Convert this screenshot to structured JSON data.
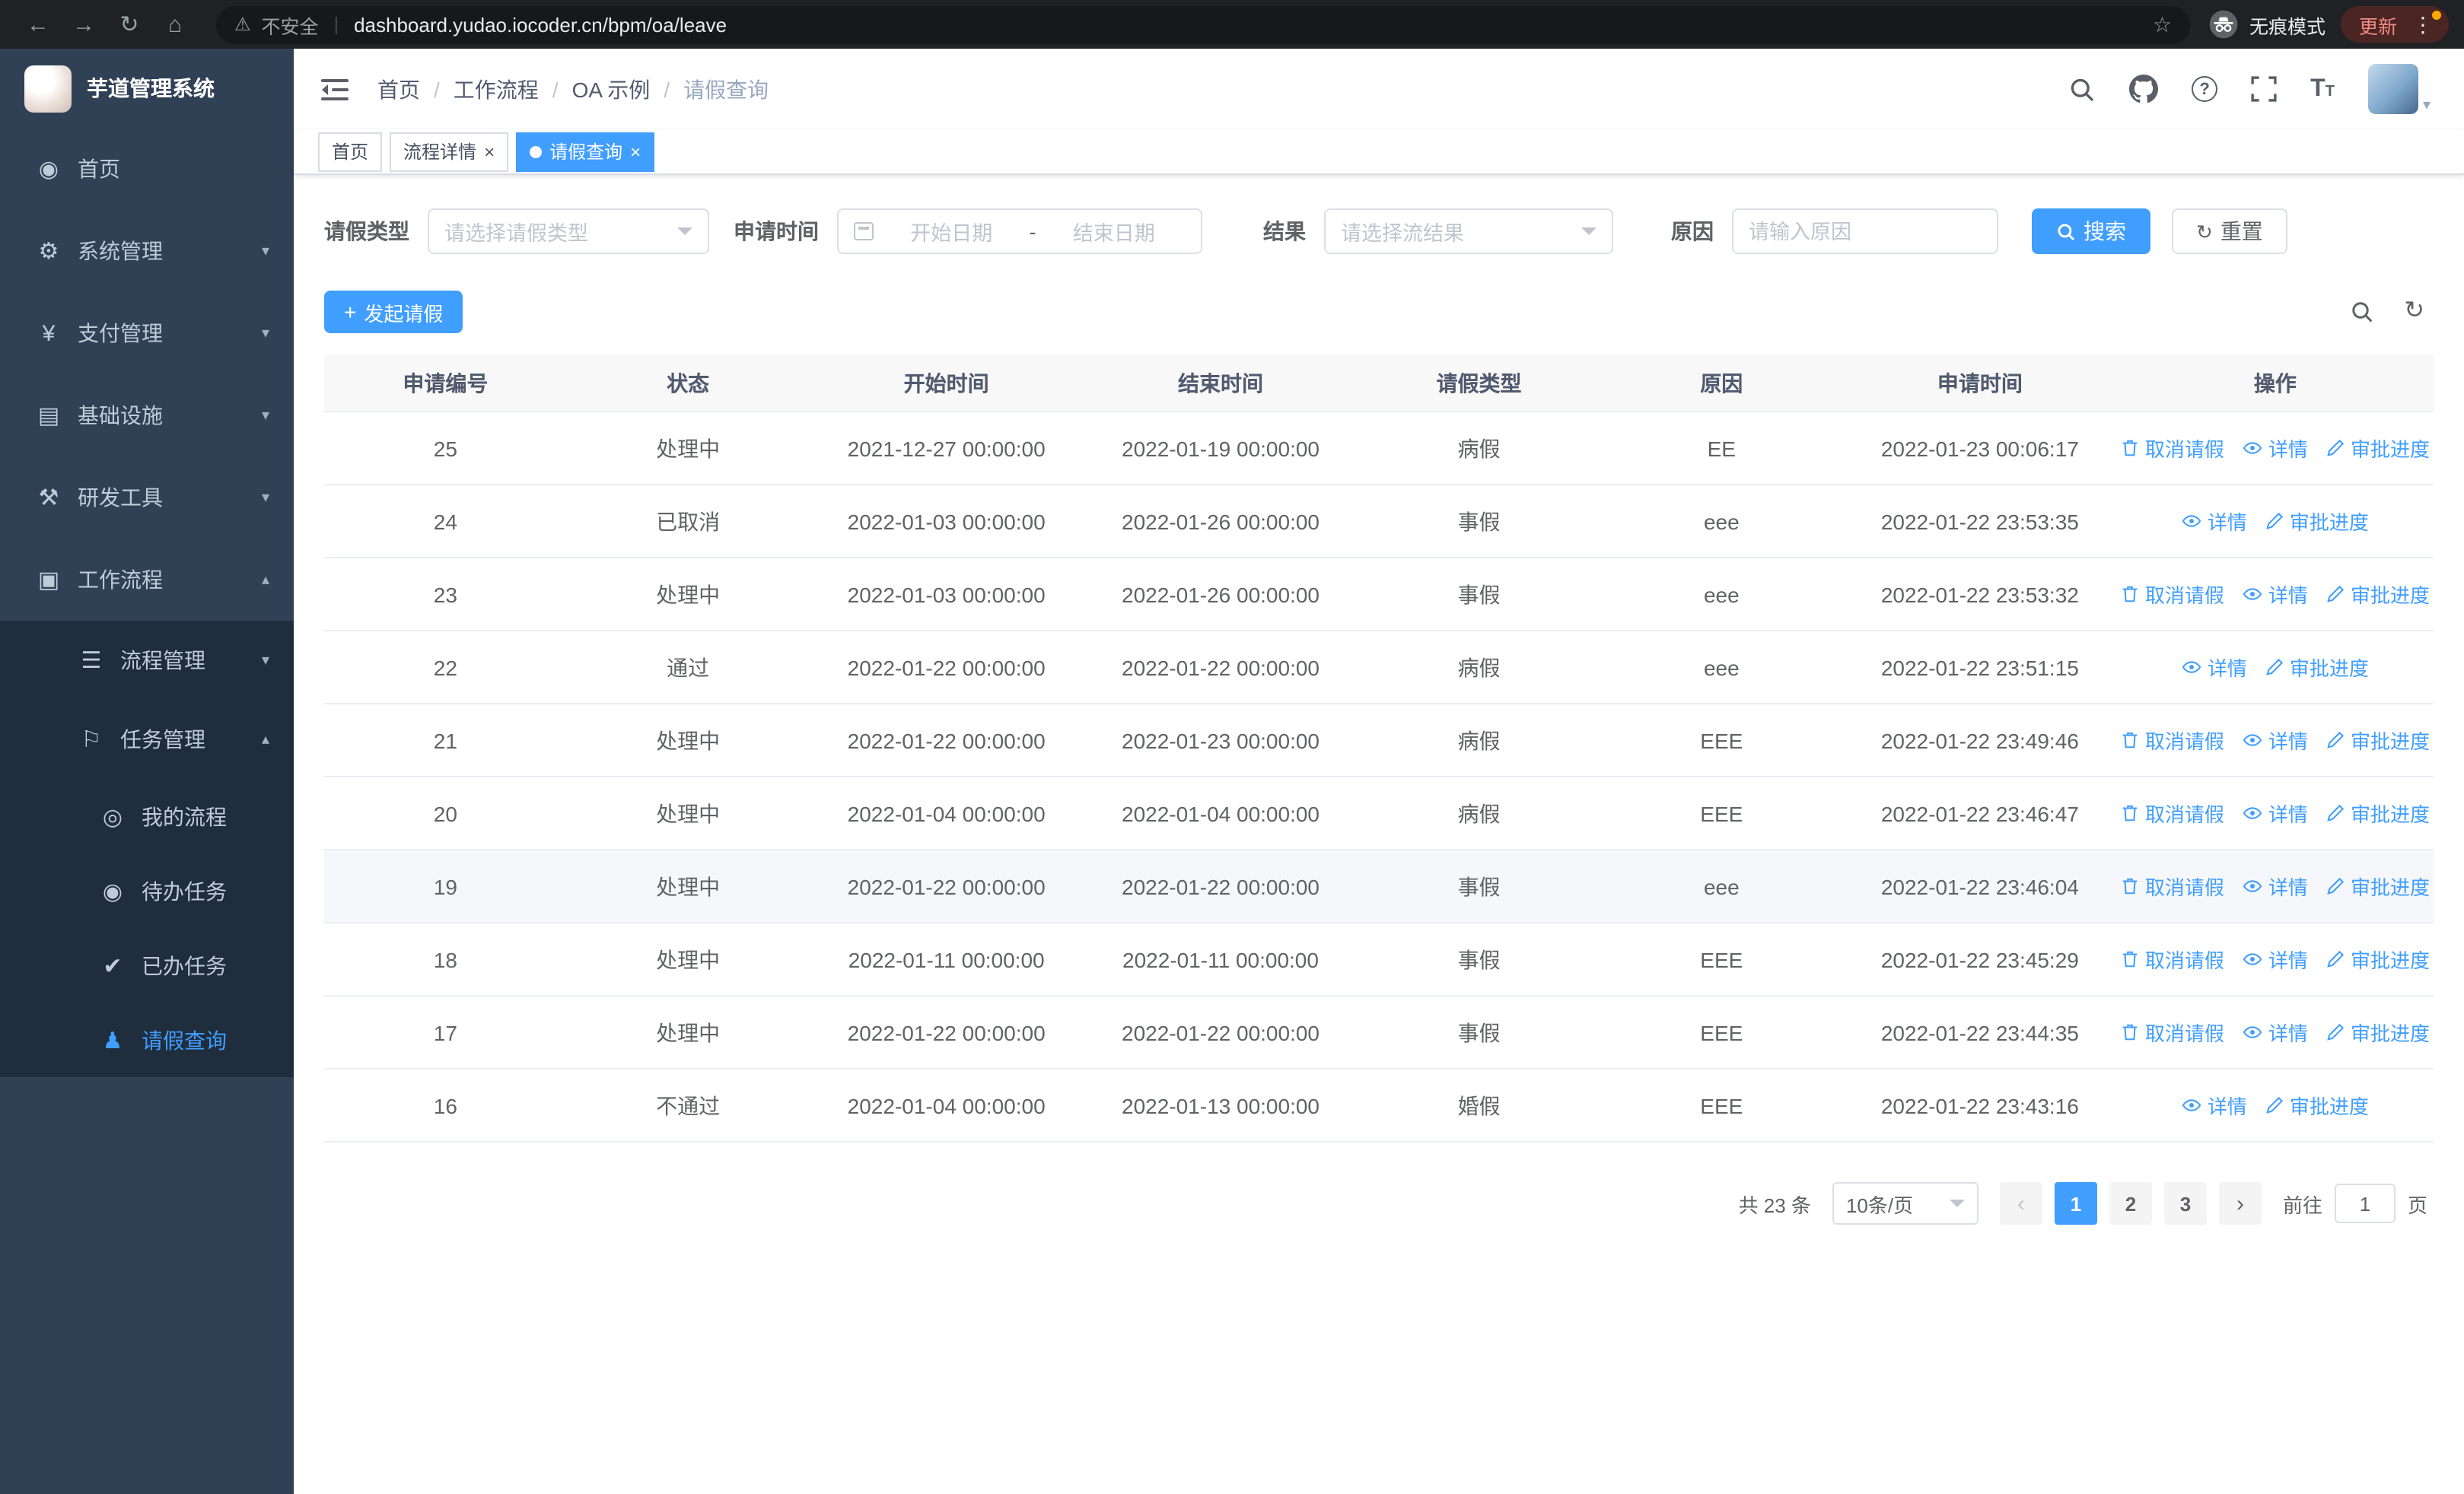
{
  "browser": {
    "security_label": "不安全",
    "url": "dashboard.yudao.iocoder.cn/bpm/oa/leave",
    "incognito_label": "无痕模式",
    "update_label": "更新"
  },
  "icons": {
    "back": "←",
    "forward": "→",
    "reload": "↻",
    "home": "⌂",
    "warning": "⚠",
    "star": "☆",
    "kebab": "⋮",
    "dashboard": "◉",
    "gear": "⚙",
    "payment": "¥",
    "infra": "▤",
    "tools": "⚒",
    "workflow": "▣",
    "process": "☰",
    "task": "⚐",
    "my_process": "◎",
    "todo": "◉",
    "done": "✔",
    "user": "♟",
    "chevron_down": "▾",
    "chevron_up": "▴",
    "close": "×",
    "plus": "+",
    "help": "?",
    "fontsize": "T",
    "refresh": "↻",
    "prev": "‹",
    "next": "›",
    "avatar_caret": "▾",
    "breadcrumb_separator": "/"
  },
  "sidebar": {
    "logo_title": "芋道管理系统",
    "items": [
      {
        "label": "首页"
      },
      {
        "label": "系统管理"
      },
      {
        "label": "支付管理"
      },
      {
        "label": "基础设施"
      },
      {
        "label": "研发工具"
      },
      {
        "label": "工作流程"
      }
    ],
    "workflow_children": [
      {
        "label": "流程管理"
      },
      {
        "label": "任务管理"
      }
    ],
    "task_children": [
      {
        "label": "我的流程"
      },
      {
        "label": "待办任务"
      },
      {
        "label": "已办任务"
      },
      {
        "label": "请假查询"
      }
    ]
  },
  "header": {
    "breadcrumb": [
      "首页",
      "工作流程",
      "OA 示例",
      "请假查询"
    ]
  },
  "tabs": [
    {
      "label": "首页"
    },
    {
      "label": "流程详情"
    },
    {
      "label": "请假查询"
    }
  ],
  "filters": {
    "leave_type_label": "请假类型",
    "leave_type_placeholder": "请选择请假类型",
    "apply_time_label": "申请时间",
    "start_date_placeholder": "开始日期",
    "date_separator": "-",
    "end_date_placeholder": "结束日期",
    "result_label": "结果",
    "result_placeholder": "请选择流结果",
    "reason_label": "原因",
    "reason_placeholder": "请输入原因",
    "search_button": "搜索",
    "reset_button": "重置"
  },
  "toolbar": {
    "create_button": "发起请假"
  },
  "table": {
    "columns": [
      "申请编号",
      "状态",
      "开始时间",
      "结束时间",
      "请假类型",
      "原因",
      "申请时间",
      "操作"
    ],
    "action_labels": {
      "cancel": "取消请假",
      "detail": "详情",
      "progress": "审批进度"
    },
    "rows": [
      {
        "id": "25",
        "status": "处理中",
        "start": "2021-12-27 00:00:00",
        "end": "2022-01-19 00:00:00",
        "type": "病假",
        "reason": "EE",
        "apply_time": "2022-01-23 00:06:17",
        "cancelable": true,
        "highlighted": false
      },
      {
        "id": "24",
        "status": "已取消",
        "start": "2022-01-03 00:00:00",
        "end": "2022-01-26 00:00:00",
        "type": "事假",
        "reason": "eee",
        "apply_time": "2022-01-22 23:53:35",
        "cancelable": false,
        "highlighted": false
      },
      {
        "id": "23",
        "status": "处理中",
        "start": "2022-01-03 00:00:00",
        "end": "2022-01-26 00:00:00",
        "type": "事假",
        "reason": "eee",
        "apply_time": "2022-01-22 23:53:32",
        "cancelable": true,
        "highlighted": false
      },
      {
        "id": "22",
        "status": "通过",
        "start": "2022-01-22 00:00:00",
        "end": "2022-01-22 00:00:00",
        "type": "病假",
        "reason": "eee",
        "apply_time": "2022-01-22 23:51:15",
        "cancelable": false,
        "highlighted": false
      },
      {
        "id": "21",
        "status": "处理中",
        "start": "2022-01-22 00:00:00",
        "end": "2022-01-23 00:00:00",
        "type": "病假",
        "reason": "EEE",
        "apply_time": "2022-01-22 23:49:46",
        "cancelable": true,
        "highlighted": false
      },
      {
        "id": "20",
        "status": "处理中",
        "start": "2022-01-04 00:00:00",
        "end": "2022-01-04 00:00:00",
        "type": "病假",
        "reason": "EEE",
        "apply_time": "2022-01-22 23:46:47",
        "cancelable": true,
        "highlighted": false
      },
      {
        "id": "19",
        "status": "处理中",
        "start": "2022-01-22 00:00:00",
        "end": "2022-01-22 00:00:00",
        "type": "事假",
        "reason": "eee",
        "apply_time": "2022-01-22 23:46:04",
        "cancelable": true,
        "highlighted": true
      },
      {
        "id": "18",
        "status": "处理中",
        "start": "2022-01-11 00:00:00",
        "end": "2022-01-11 00:00:00",
        "type": "事假",
        "reason": "EEE",
        "apply_time": "2022-01-22 23:45:29",
        "cancelable": true,
        "highlighted": false
      },
      {
        "id": "17",
        "status": "处理中",
        "start": "2022-01-22 00:00:00",
        "end": "2022-01-22 00:00:00",
        "type": "事假",
        "reason": "EEE",
        "apply_time": "2022-01-22 23:44:35",
        "cancelable": true,
        "highlighted": false
      },
      {
        "id": "16",
        "status": "不通过",
        "start": "2022-01-04 00:00:00",
        "end": "2022-01-13 00:00:00",
        "type": "婚假",
        "reason": "EEE",
        "apply_time": "2022-01-22 23:43:16",
        "cancelable": false,
        "highlighted": false
      }
    ]
  },
  "pagination": {
    "total_text": "共 23 条",
    "page_size": "10条/页",
    "pages": [
      "1",
      "2",
      "3"
    ],
    "active_page": "1",
    "goto_label": "前往",
    "goto_value": "1",
    "goto_suffix": "页"
  },
  "colors": {
    "primary": "#409eff",
    "sidebar_bg": "#304156",
    "sidebar_submenu_bg": "#1f2d3d",
    "chrome_bg": "#202124",
    "table_header_bg": "#f8f8f9"
  }
}
